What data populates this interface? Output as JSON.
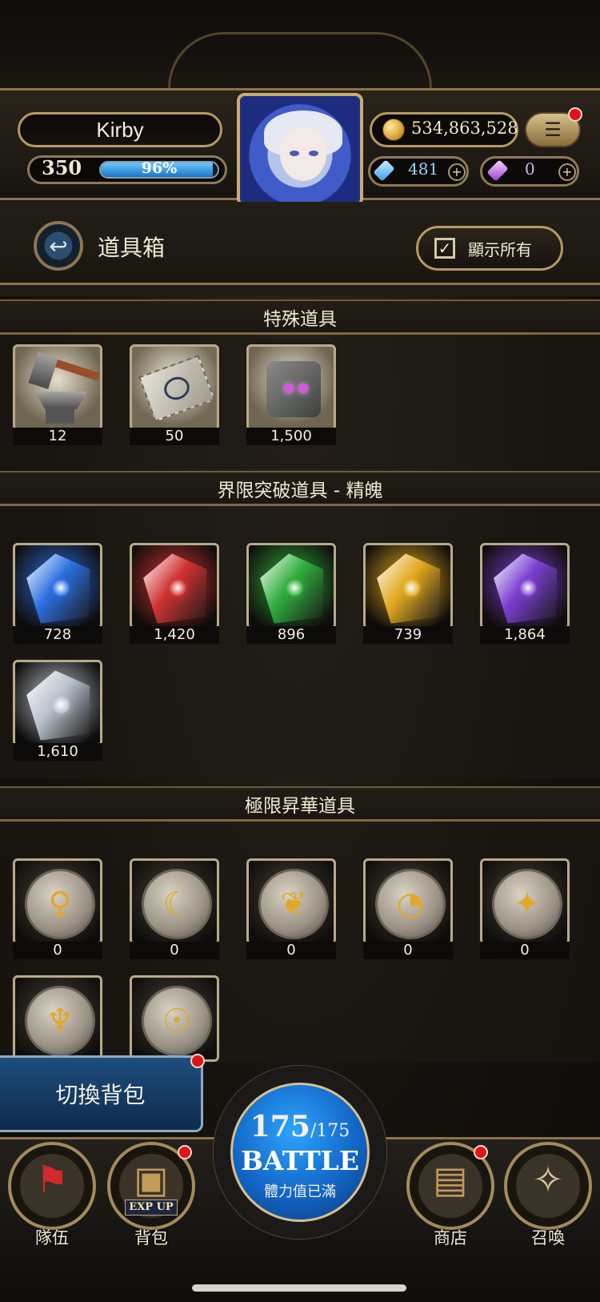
{
  "player": {
    "name": "Kirby",
    "level": "350",
    "exp_percent_text": "96%",
    "exp_fraction": 0.96
  },
  "currency": {
    "gold": "534,863,528",
    "blue_gems": "481",
    "purple_gems": "0"
  },
  "header": {
    "title": "道具箱",
    "show_all_label": "顯示所有"
  },
  "sections": {
    "special": {
      "title": "特殊道具",
      "items": [
        {
          "name": "anvil-hammer",
          "count": "12"
        },
        {
          "name": "ticket",
          "count": "50"
        },
        {
          "name": "cube",
          "count": "1,500"
        }
      ]
    },
    "limit_break": {
      "title": "界限突破道具 - 精魄",
      "items": [
        {
          "name": "water-soul",
          "count": "728",
          "color": "#2b6fe0"
        },
        {
          "name": "fire-soul",
          "count": "1,420",
          "color": "#d13232"
        },
        {
          "name": "wood-soul",
          "count": "896",
          "color": "#2fae3c"
        },
        {
          "name": "light-soul",
          "count": "739",
          "color": "#e2a91e"
        },
        {
          "name": "dark-soul",
          "count": "1,864",
          "color": "#7a3fd0"
        },
        {
          "name": "neutral-soul",
          "count": "1,610",
          "color": "#b9c1cc"
        }
      ]
    },
    "ascension": {
      "title": "極限昇華道具",
      "items": [
        {
          "name": "rune-coin-1",
          "count": "0",
          "symbol": "♀"
        },
        {
          "name": "rune-coin-2",
          "count": "0",
          "symbol": "☾"
        },
        {
          "name": "rune-coin-3",
          "count": "0",
          "symbol": "❦"
        },
        {
          "name": "rune-coin-4",
          "count": "0",
          "symbol": "◔"
        },
        {
          "name": "rune-coin-5",
          "count": "0",
          "symbol": "✦"
        },
        {
          "name": "rune-coin-6",
          "count": "",
          "symbol": "♆"
        },
        {
          "name": "rune-coin-7",
          "count": "",
          "symbol": "☉"
        }
      ]
    }
  },
  "bottom": {
    "switch_bag": "切換背包",
    "team": "隊伍",
    "bag": "背包",
    "exp_up": "EXP UP",
    "shop": "商店",
    "summon": "召喚",
    "stamina_current": "175",
    "stamina_max": "/175",
    "battle": "BATTLE",
    "battle_sub": "體力值已滿"
  }
}
